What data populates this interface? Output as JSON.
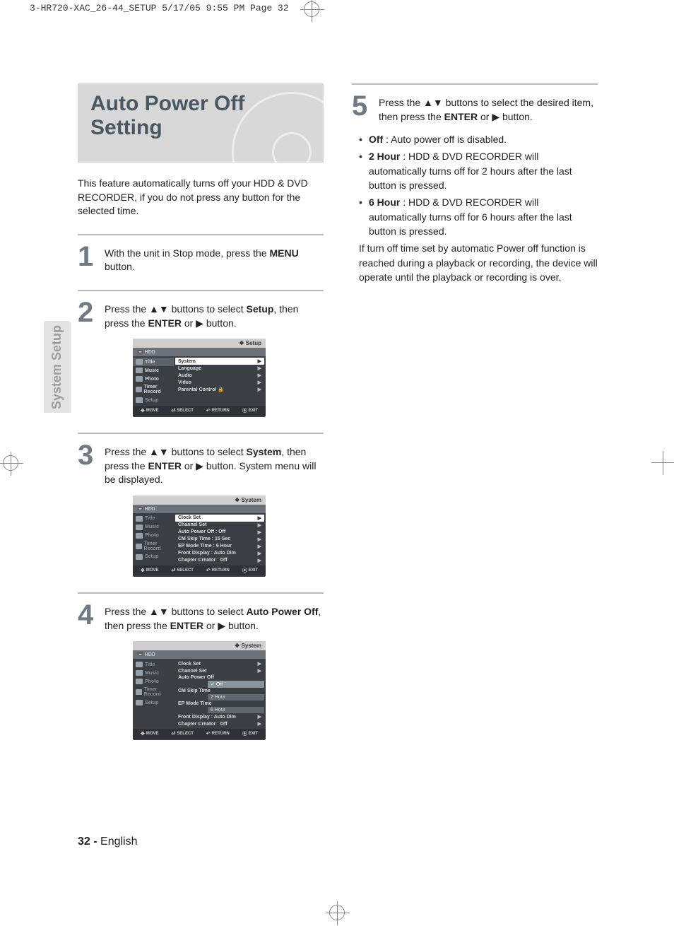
{
  "crop_header": "3-HR720-XAC_26-44_SETUP  5/17/05  9:55 PM  Page 32",
  "side_tab": "System Setup",
  "title": "Auto Power Off Setting",
  "intro": "This feature automatically turns off your HDD & DVD RECORDER, if you do not press any button for the selected time.",
  "steps": {
    "s1": {
      "num": "1",
      "pre": "With the unit in Stop mode, press the ",
      "bold": "MENU",
      "post": " button."
    },
    "s2": {
      "num": "2",
      "t1": "Press the ",
      "arrows": "▲▼",
      "t2": " buttons to select ",
      "bold": "Setup",
      "t3": ", then press the ",
      "bold2": "ENTER",
      "t4": " or ",
      "play": "▶",
      "t5": " button."
    },
    "s3": {
      "num": "3",
      "t1": "Press the ",
      "arrows": "▲▼",
      "t2": " buttons to select ",
      "bold": "System",
      "t3": ", then press the ",
      "bold2": "ENTER",
      "t4": " or ",
      "play": "▶",
      "t5": " button. System menu will be displayed."
    },
    "s4": {
      "num": "4",
      "t1": "Press the ",
      "arrows": "▲▼",
      "t2": " buttons to select ",
      "bold": "Auto Power Off",
      "t3": ", then press the ",
      "bold2": "ENTER",
      "t4": " or ",
      "play": "▶",
      "t5": " button."
    },
    "s5": {
      "num": "5",
      "t1": "Press the ",
      "arrows": "▲▼",
      "t2": " buttons to select the desired item, then press the ",
      "bold": "ENTER",
      "t3": " or ",
      "play": "▶",
      "t4": " button."
    }
  },
  "screen_common": {
    "hdd": "HDD",
    "nav": {
      "title": "Title",
      "music": "Music",
      "photo": "Photo",
      "timer": "Timer Record",
      "setup": "Setup"
    },
    "keys": {
      "move": "MOVE",
      "select": "SELECT",
      "return": "RETURN",
      "exit": "EXIT"
    }
  },
  "screen1": {
    "header": "Setup",
    "menu": {
      "system": "System",
      "language": "Language",
      "audio": "Audio",
      "video": "Video",
      "parental": "Parental Control"
    },
    "lock_icon": "🔒"
  },
  "screen2": {
    "header": "System",
    "menu": {
      "clock": "Clock Set",
      "channel": "Channel Set",
      "autopower": "Auto Power Off",
      "autopower_val": ": Off",
      "cmskip": "CM Skip Time",
      "cmskip_val": ": 15 Sec",
      "epmode": "EP Mode Time",
      "epmode_val": ": 6 Hour",
      "front": "Front Display",
      "front_val": ": Auto Dim",
      "chapter": "Chapter Creator",
      "chapter_val": ": Off"
    }
  },
  "screen3": {
    "header": "System",
    "menu": {
      "clock": "Clock Set",
      "channel": "Channel Set",
      "autopower": "Auto Power Off",
      "cmskip": "CM Skip Time",
      "epmode": "EP Mode Time",
      "front": "Front Display",
      "front_val": ": Auto Dim",
      "chapter": "Chapter Creator",
      "chapter_val": ": Off"
    },
    "options": {
      "off": "Off",
      "h2": "2 Hour",
      "h6": "6 Hour"
    },
    "check": "✓"
  },
  "bullets": {
    "off_label": "Off",
    "off_desc": " : Auto power off is disabled.",
    "h2_label": "2 Hour",
    "h2_desc": " : HDD & DVD RECORDER will automatically turns off for 2 hours after the last button is pressed.",
    "h6_label": "6 Hour",
    "h6_desc": " : HDD & DVD RECORDER will automatically turns off for 6 hours after the last button is pressed.",
    "note": "If turn off time set by automatic Power off function is reached during a playback or recording, the device will operate until the playback or recording is over."
  },
  "footer": {
    "page": "32 -",
    "lang": " English"
  }
}
